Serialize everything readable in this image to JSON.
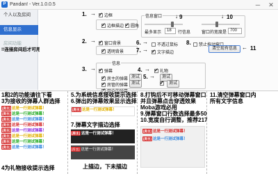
{
  "window": {
    "title": "Pandan! - Ver.1.0.0.5",
    "minimize": "─",
    "close": "✕",
    "app_icon_char": "P"
  },
  "sidebar": {
    "items": [
      {
        "label": "个人以及房间"
      },
      {
        "label": "信息显示"
      },
      {
        "label": "房间功能"
      }
    ],
    "notice": "!!连接房间后才可用"
  },
  "panel": {
    "border_label": "边框",
    "border_draw_label": "边框描边",
    "rounded_label": "圆角",
    "info_window_group": "信息窗口",
    "min_display_label": "最多显示",
    "min_display_value": "18",
    "min_display_unit": "行信息",
    "width_label": "窗口的宽度是",
    "width_value": "700",
    "window_bg_label": "窗口背景",
    "transparent_bg_label": "透明背景",
    "no_move_label": "不透过鼠标",
    "lock_window_label": "禁止拖动窗口",
    "text_stroke_label": "文字描边",
    "clear_button": "清空现有信息",
    "info_group": "信息",
    "danmaku_label": "弹幕",
    "gift_label": "礼物",
    "room_manager_label": "房主的弹幕",
    "room_admin_label": "房管的弹幕",
    "viewer_label": "观众的弹幕",
    "test_button": "测试"
  },
  "annotations": {
    "n1": "1.",
    "n2": "2.",
    "n3": "3.",
    "n4": "4.",
    "n5": "5.",
    "n6": "6.",
    "n7": "7.",
    "n8": "8.",
    "n9": "9",
    "n10": "10",
    "n11": "11"
  },
  "notes": {
    "col1": [
      "1和2的功能请往下看",
      "3为接收的弹幕人群选择"
    ],
    "col1_footer": "4为礼物接收提示选择",
    "col2": [
      "5.为系统信息接收提示选择",
      "6.弹出的弹幕效果显示选择"
    ],
    "col2_mid": "7.弹幕文字描边选择",
    "col2_footer": "上描边，下未描边",
    "col3": [
      "8.打钩后不可移动弹幕窗口",
      "并且弹幕点击穿透效果",
      "Moba游戏必用",
      "9.弹幕窗口行数选择最多50",
      "10.宽度自行调整，推荐217"
    ],
    "col4": [
      "11.清空弹幕窗口内",
      "所有文字信息"
    ]
  },
  "demo": {
    "pill": "[房主]",
    "sender": "狐米:",
    "text": "这是一行测试弹幕！",
    "colors": [
      "#e0b000",
      "#22aa22",
      "#3b8be0",
      "#d42a2a",
      "#8a2be2",
      "#e0b000",
      "#22aa22",
      "#3b8be0"
    ]
  },
  "colors": {
    "accent": "#2f6fcf"
  }
}
